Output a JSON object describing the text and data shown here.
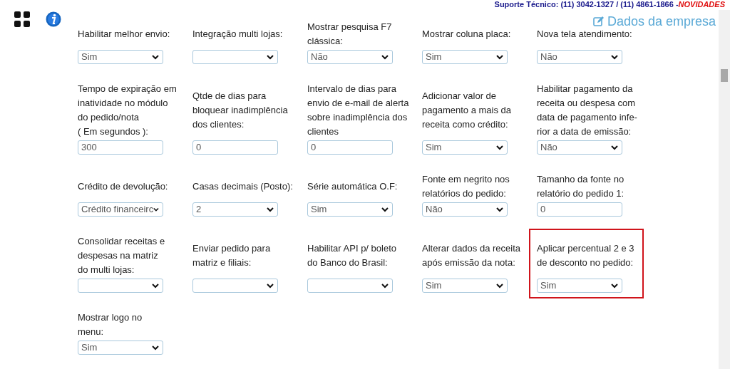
{
  "header": {
    "support": "Suporte Técnico: (11) 3042-1327 / (11) 4861-1866 - ",
    "news_link": "NOVIDADES",
    "company_link": "Dados da empresa"
  },
  "rows": [
    [
      {
        "label": [
          "Habilitar melhor envio:"
        ],
        "kind": "select",
        "value": "Sim",
        "highlighted": false
      },
      {
        "label": [
          "Integração multi lojas:"
        ],
        "kind": "select",
        "highlighted": false
      },
      {
        "label": [
          "Mostrar pesquisa F7",
          "clássica:"
        ],
        "kind": "select",
        "value": "Não",
        "highlighted": false
      },
      {
        "label": [
          "Mostrar coluna placa:"
        ],
        "kind": "select",
        "value": "Sim",
        "highlighted": false
      },
      {
        "label": [
          "Nova tela atendimento:"
        ],
        "kind": "select",
        "value": "Não",
        "highlighted": false
      }
    ],
    [
      {
        "label": [
          "Tempo de expiração em",
          "inatividade no módulo",
          "do pedido/nota",
          "( Em segundos ):"
        ],
        "kind": "text",
        "value": "300",
        "highlighted": false
      },
      {
        "label": [
          "Qtde de dias para",
          "bloquear inadimplência",
          "dos clientes:"
        ],
        "kind": "text",
        "value": "0",
        "highlighted": false
      },
      {
        "label": [
          "Intervalo de dias para",
          "envio de e-mail de alerta",
          "sobre inadimplência dos",
          "clientes"
        ],
        "kind": "text",
        "value": "0",
        "highlighted": false
      },
      {
        "label": [
          "Adicionar valor de",
          "pagamento a mais da",
          "receita como crédito:"
        ],
        "kind": "select",
        "value": "Sim",
        "highlighted": false
      },
      {
        "label": [
          "Habilitar pagamento da",
          "receita ou despesa com",
          "data de pagamento infe-",
          "rior a data de emissão:"
        ],
        "kind": "select",
        "value": "Não",
        "highlighted": false
      }
    ],
    [
      {
        "label": [
          "Crédito de devolução:"
        ],
        "kind": "select",
        "value": "Crédito financeirc",
        "highlighted": false
      },
      {
        "label": [
          "Casas decimais (Posto):"
        ],
        "kind": "select",
        "value": "2",
        "highlighted": false
      },
      {
        "label": [
          "Série automática O.F:"
        ],
        "kind": "select",
        "value": "Sim",
        "highlighted": false
      },
      {
        "label": [
          "Fonte em negrito nos",
          "relatórios do pedido:"
        ],
        "kind": "select",
        "value": "Não",
        "highlighted": false
      },
      {
        "label": [
          "Tamanho da fonte no",
          "relatório do pedido 1:"
        ],
        "kind": "text",
        "value": "0",
        "highlighted": false
      }
    ],
    [
      {
        "label": [
          "Consolidar receitas e",
          "despesas na matriz",
          "do multi lojas:"
        ],
        "kind": "select",
        "highlighted": false
      },
      {
        "label": [
          "Enviar pedido para",
          "matriz e filiais:"
        ],
        "kind": "select",
        "highlighted": false
      },
      {
        "label": [
          "Habilitar API p/ boleto",
          "do Banco do Brasil:"
        ],
        "kind": "select",
        "highlighted": false
      },
      {
        "label": [
          "Alterar dados da receita",
          "após emissão da nota:"
        ],
        "kind": "select",
        "value": "Sim",
        "highlighted": false
      },
      {
        "label": [
          "Aplicar percentual 2 e 3",
          "de desconto no pedido:"
        ],
        "kind": "select",
        "value": "Sim",
        "highlighted": true
      }
    ],
    [
      {
        "label": [
          "Mostrar logo no",
          "menu:"
        ],
        "kind": "select",
        "value": "Sim",
        "highlighted": false
      }
    ]
  ]
}
